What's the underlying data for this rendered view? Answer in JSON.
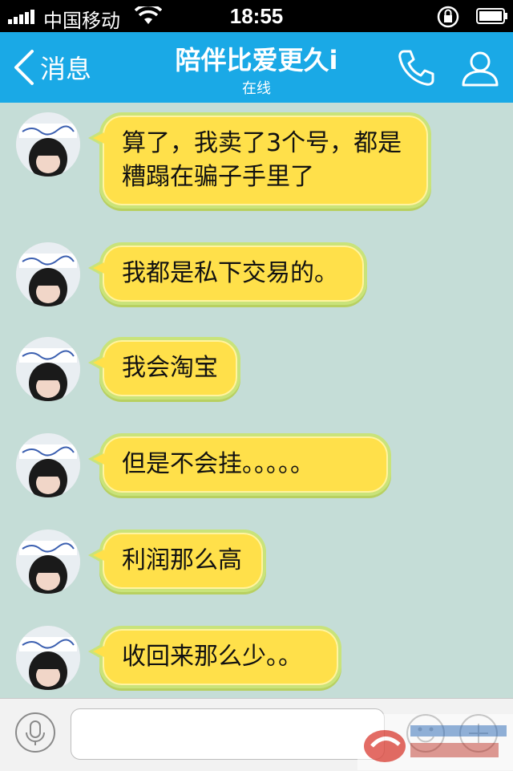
{
  "status_bar": {
    "carrier": "中国移动",
    "time": "18:55",
    "icons": [
      "signal-icon",
      "wifi-icon",
      "rotation-lock-icon",
      "battery-icon"
    ]
  },
  "nav": {
    "back_label": "消息",
    "title": "陪伴比爱更久i",
    "status": "在线",
    "icons": [
      "back-chevron-icon",
      "phone-icon",
      "profile-icon"
    ]
  },
  "messages": [
    {
      "text": "算了，我卖了3个号，都是糟蹋在骗子手里了"
    },
    {
      "text": "我都是私下交易的。"
    },
    {
      "text": "我会淘宝"
    },
    {
      "text": "但是不会挂。。。。。"
    },
    {
      "text": "利润那么高"
    },
    {
      "text": "收回来那么少。。"
    }
  ],
  "input_bar": {
    "value": "",
    "icons": [
      "microphone-icon",
      "emoji-icon",
      "plus-icon"
    ]
  },
  "colors": {
    "nav_bar": "#1aa9e6",
    "chat_background": "#c5ddd7",
    "bubble_fill": "#ffe04a",
    "bubble_border": "#c9e37a"
  }
}
